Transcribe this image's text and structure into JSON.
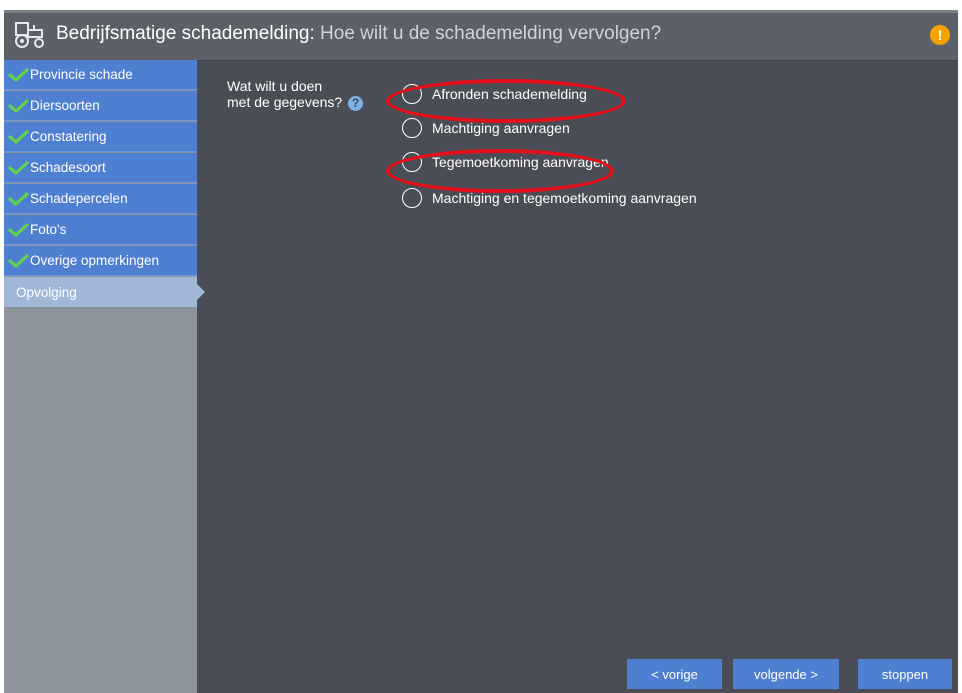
{
  "header": {
    "title": "Bedrijfsmatige schademelding:",
    "subtitle": "Hoe wilt u de schademelding vervolgen?",
    "logo_icon": "tractor-icon",
    "alert_icon": "warning-icon",
    "alert_symbol": "!"
  },
  "sidebar": {
    "items": [
      {
        "label": "Provincie schade",
        "done": true
      },
      {
        "label": "Diersoorten",
        "done": true
      },
      {
        "label": "Constatering",
        "done": true
      },
      {
        "label": "Schadesoort",
        "done": true
      },
      {
        "label": "Schadepercelen",
        "done": true
      },
      {
        "label": "Foto's",
        "done": true
      },
      {
        "label": "Overige opmerkingen",
        "done": true
      },
      {
        "label": "Opvolging",
        "done": false,
        "active": true
      }
    ]
  },
  "question": {
    "line1": "Wat wilt u doen",
    "line2": "met de gegevens?",
    "help_symbol": "?"
  },
  "options": [
    {
      "label": "Afronden schademelding",
      "highlighted": true
    },
    {
      "label": "Machtiging aanvragen",
      "highlighted": false
    },
    {
      "label": "Tegemoetkoming aanvragen",
      "highlighted": true
    },
    {
      "label": "Machtiging en tegemoetkoming aanvragen",
      "highlighted": false
    }
  ],
  "buttons": {
    "prev": "< vorige",
    "next": "volgende >",
    "stop": "stoppen"
  },
  "colors": {
    "accent": "#4f7fd1",
    "highlight_ring": "#e3101b",
    "warning": "#f3a200"
  }
}
